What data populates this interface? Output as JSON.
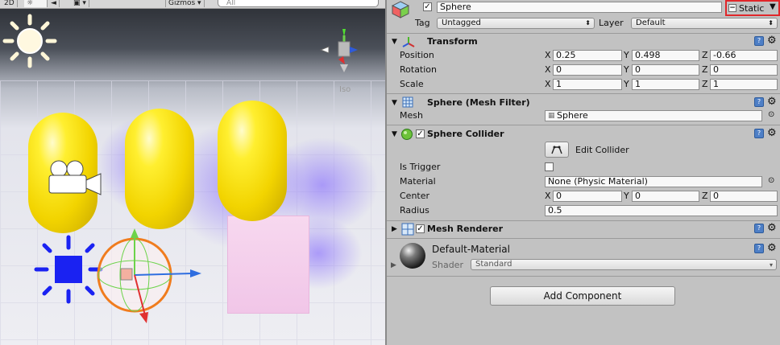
{
  "scene": {
    "toolbar": {
      "mode_2d": "2D",
      "light_icon": "sun-icon",
      "audio_icon": "speaker-icon",
      "effects_icon": "image-icon",
      "gizmos_label": "Gizmos",
      "search_placeholder": "All"
    },
    "iso_label": "Iso"
  },
  "inspector": {
    "header": {
      "object_name": "Sphere",
      "static_label": "Static",
      "tag_label": "Tag",
      "tag_value": "Untagged",
      "layer_label": "Layer",
      "layer_value": "Default"
    },
    "transform": {
      "title": "Transform",
      "position_label": "Position",
      "rotation_label": "Rotation",
      "scale_label": "Scale",
      "axis_x": "X",
      "axis_y": "Y",
      "axis_z": "Z",
      "position": {
        "x": "0.25",
        "y": "0.498",
        "z": "-0.66"
      },
      "rotation": {
        "x": "0",
        "y": "0",
        "z": "0"
      },
      "scale": {
        "x": "1",
        "y": "1",
        "z": "1"
      }
    },
    "mesh_filter": {
      "title": "Sphere (Mesh Filter)",
      "mesh_label": "Mesh",
      "mesh_value": "Sphere"
    },
    "sphere_collider": {
      "title": "Sphere Collider",
      "edit_collider_label": "Edit Collider",
      "is_trigger_label": "Is Trigger",
      "material_label": "Material",
      "material_value": "None (Physic Material)",
      "center_label": "Center",
      "center": {
        "x": "0",
        "y": "0",
        "z": "0"
      },
      "radius_label": "Radius",
      "radius_value": "0.5"
    },
    "mesh_renderer": {
      "title": "Mesh Renderer"
    },
    "material": {
      "name": "Default-Material",
      "shader_label": "Shader",
      "shader_value": "Standard"
    },
    "add_component_label": "Add Component"
  },
  "colors": {
    "inspector_bg": "#c2c2c2",
    "capsule_yellow": "#f2d400",
    "light_blue": "#1a22f2",
    "static_highlight": "#e0262a"
  }
}
